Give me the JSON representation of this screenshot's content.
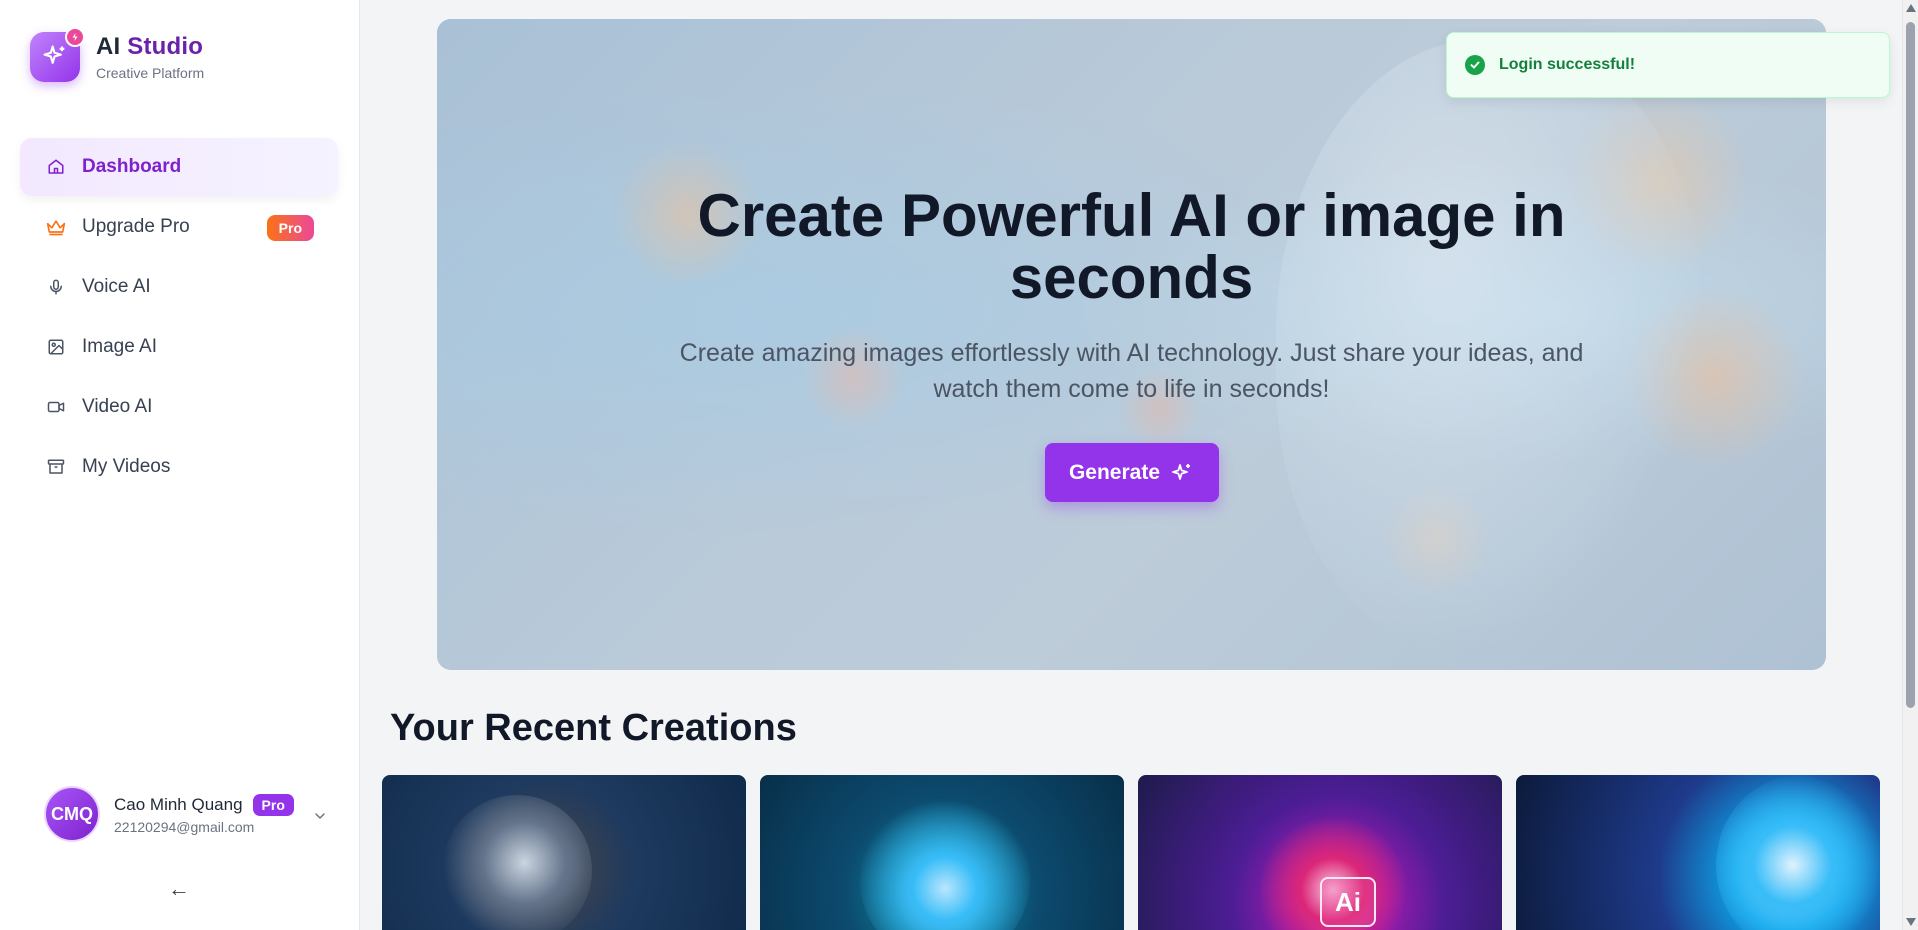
{
  "brand": {
    "title_ai": "AI",
    "title_studio": "Studio",
    "subtitle": "Creative Platform"
  },
  "sidebar": {
    "items": [
      {
        "label": "Dashboard",
        "icon": "home-icon",
        "active": true
      },
      {
        "label": "Upgrade Pro",
        "icon": "crown-icon",
        "badge": "Pro"
      },
      {
        "label": "Voice AI",
        "icon": "microphone-icon"
      },
      {
        "label": "Image AI",
        "icon": "image-icon"
      },
      {
        "label": "Video AI",
        "icon": "video-icon"
      },
      {
        "label": "My Videos",
        "icon": "archive-icon"
      }
    ],
    "collapse_label": "←"
  },
  "user": {
    "initials": "CMQ",
    "name": "Cao Minh Quang",
    "badge": "Pro",
    "email": "22120294@gmail.com"
  },
  "hero": {
    "title": "Create Powerful AI or image in seconds",
    "description": "Create amazing images effortlessly with AI technology. Just share your ideas, and watch them come to life in seconds!",
    "button_label": "Generate"
  },
  "toast": {
    "message": "Login successful!"
  },
  "recent": {
    "title": "Your Recent Creations",
    "ai_badge": "Ai"
  },
  "colors": {
    "accent": "#9333ea",
    "active_nav_bg": "#f3e8ff",
    "toast_green": "#16a34a"
  }
}
